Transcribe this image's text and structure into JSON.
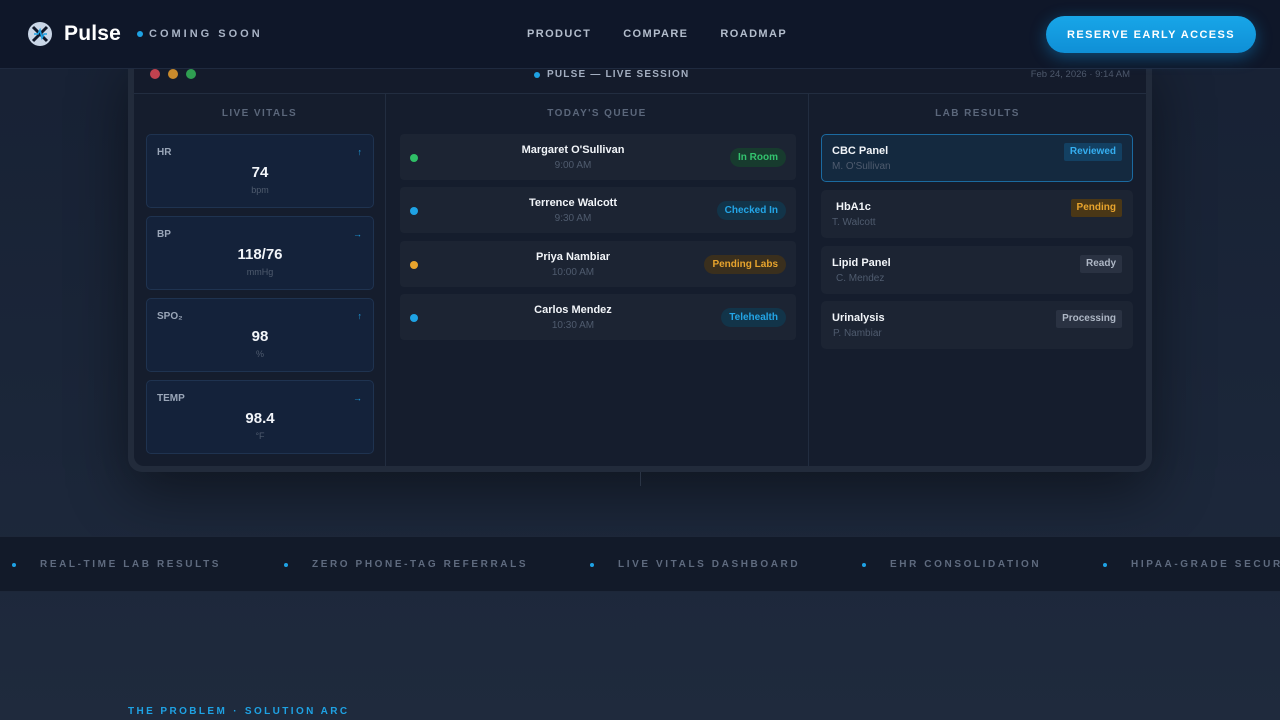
{
  "nav": {
    "brand": "Pulse",
    "status": "COMING SOON",
    "links": [
      "PRODUCT",
      "COMPARE",
      "ROADMAP"
    ],
    "cta": "RESERVE EARLY ACCESS"
  },
  "app": {
    "session_title": "PULSE — LIVE SESSION",
    "timestamp": "Feb 24, 2026 · 9:14 AM",
    "vitals_title": "LIVE VITALS",
    "queue_title": "TODAY'S QUEUE",
    "labs_title": "LAB RESULTS",
    "vitals": [
      {
        "name": "HR",
        "value": "74",
        "unit": "bpm",
        "trend": "↑"
      },
      {
        "name": "BP",
        "value": "118/76",
        "unit": "mmHg",
        "trend": "→"
      },
      {
        "name": "SPO₂",
        "value": "98",
        "unit": "%",
        "trend": "↑"
      },
      {
        "name": "TEMP",
        "value": "98.4",
        "unit": "°F",
        "trend": "→"
      }
    ],
    "queue": [
      {
        "name": "Margaret O'Sullivan",
        "time": "9:00 AM",
        "status": "In Room",
        "tone": "green",
        "dot": "#2fbf67"
      },
      {
        "name": "Terrence Walcott",
        "time": "9:30 AM",
        "status": "Checked In",
        "tone": "blue",
        "dot": "#1ea2e4"
      },
      {
        "name": "Priya Nambiar",
        "time": "10:00 AM",
        "status": "Pending Labs",
        "tone": "amber",
        "dot": "#e8a42d"
      },
      {
        "name": "Carlos Mendez",
        "time": "10:30 AM",
        "status": "Telehealth",
        "tone": "blue",
        "dot": "#1ea2e4"
      }
    ],
    "labs": [
      {
        "test": "CBC Panel",
        "patient": "M. O'Sullivan",
        "status": "Reviewed",
        "tone": "blue"
      },
      {
        "test": "HbA1c",
        "patient": "T. Walcott",
        "status": "Pending",
        "tone": "amber"
      },
      {
        "test": "Lipid Panel",
        "patient": "C. Mendez",
        "status": "Ready",
        "tone": "gray"
      },
      {
        "test": "Urinalysis",
        "patient": "P. Nambiar",
        "status": "Processing",
        "tone": "gray"
      }
    ]
  },
  "ticker": [
    "REAL-TIME LAB RESULTS",
    "ZERO PHONE-TAG REFERRALS",
    "LIVE VITALS DASHBOARD",
    "EHR CONSOLIDATION",
    "HIPAA-GRADE SECURITY"
  ],
  "section": {
    "eyebrow_left": "THE PROBLEM",
    "eyebrow_sep": "·",
    "eyebrow_right": "SOLUTION ARC"
  },
  "colors": {
    "accent": "#1ea2e4",
    "background": "#172134",
    "panel": "#151d2d"
  }
}
